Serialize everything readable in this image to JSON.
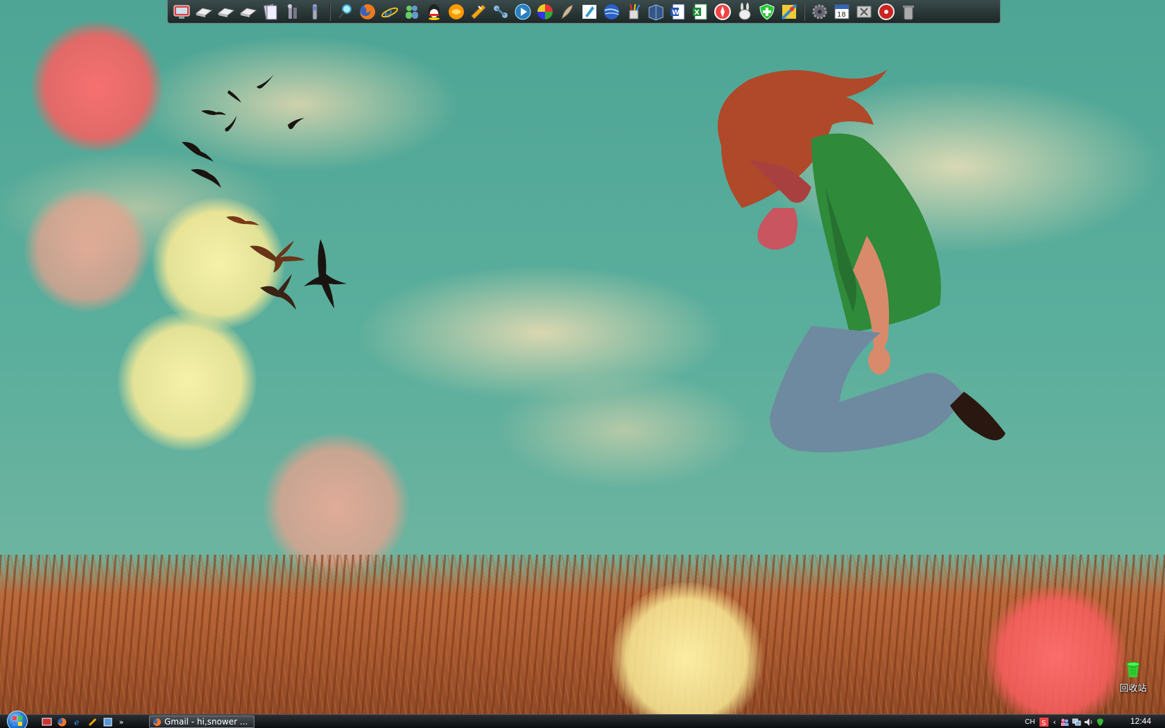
{
  "desktop": {
    "recycle_bin_label": "回收站",
    "colors": {
      "sky": "#5aa89a",
      "field": "#a85a30",
      "bokeh_red": "#ff6e6e",
      "bokeh_yellow": "#fff5aa"
    }
  },
  "dock": {
    "groups": [
      [
        "computer-icon",
        "drive-icon",
        "drive-icon",
        "drive-icon",
        "documents-icon",
        "tools-icon",
        "utility-icon"
      ],
      [
        "search-icon",
        "firefox-icon",
        "internet-explorer-icon",
        "msn-messenger-icon",
        "qq-icon",
        "chat-icon",
        "flashget-icon",
        "network-icon",
        "media-player-icon",
        "color-wheel-icon",
        "feather-icon",
        "pen-tool-icon",
        "google-earth-icon",
        "paint-icon",
        "book-icon",
        "word-icon",
        "excel-icon",
        "compass-icon",
        "rabbit-icon",
        "shield-plus-icon",
        "maps-icon"
      ],
      [
        "gear-icon",
        "calendar-icon",
        "close-app-icon",
        "cd-icon",
        "trash-icon"
      ]
    ],
    "calendar_day": "18"
  },
  "taskbar": {
    "quick_launch": [
      "show-desktop-icon",
      "firefox-icon",
      "internet-explorer-icon",
      "flashget-icon",
      "media-icon"
    ],
    "quick_launch_more": "»",
    "task_button_label": "Gmail - hi,snower ...",
    "language": "CH",
    "tray_expand": "‹",
    "tray_icons": [
      "sogou-icon",
      "users-icon",
      "network-icon",
      "speaker-icon",
      "security-icon"
    ],
    "clock": "12:44"
  }
}
